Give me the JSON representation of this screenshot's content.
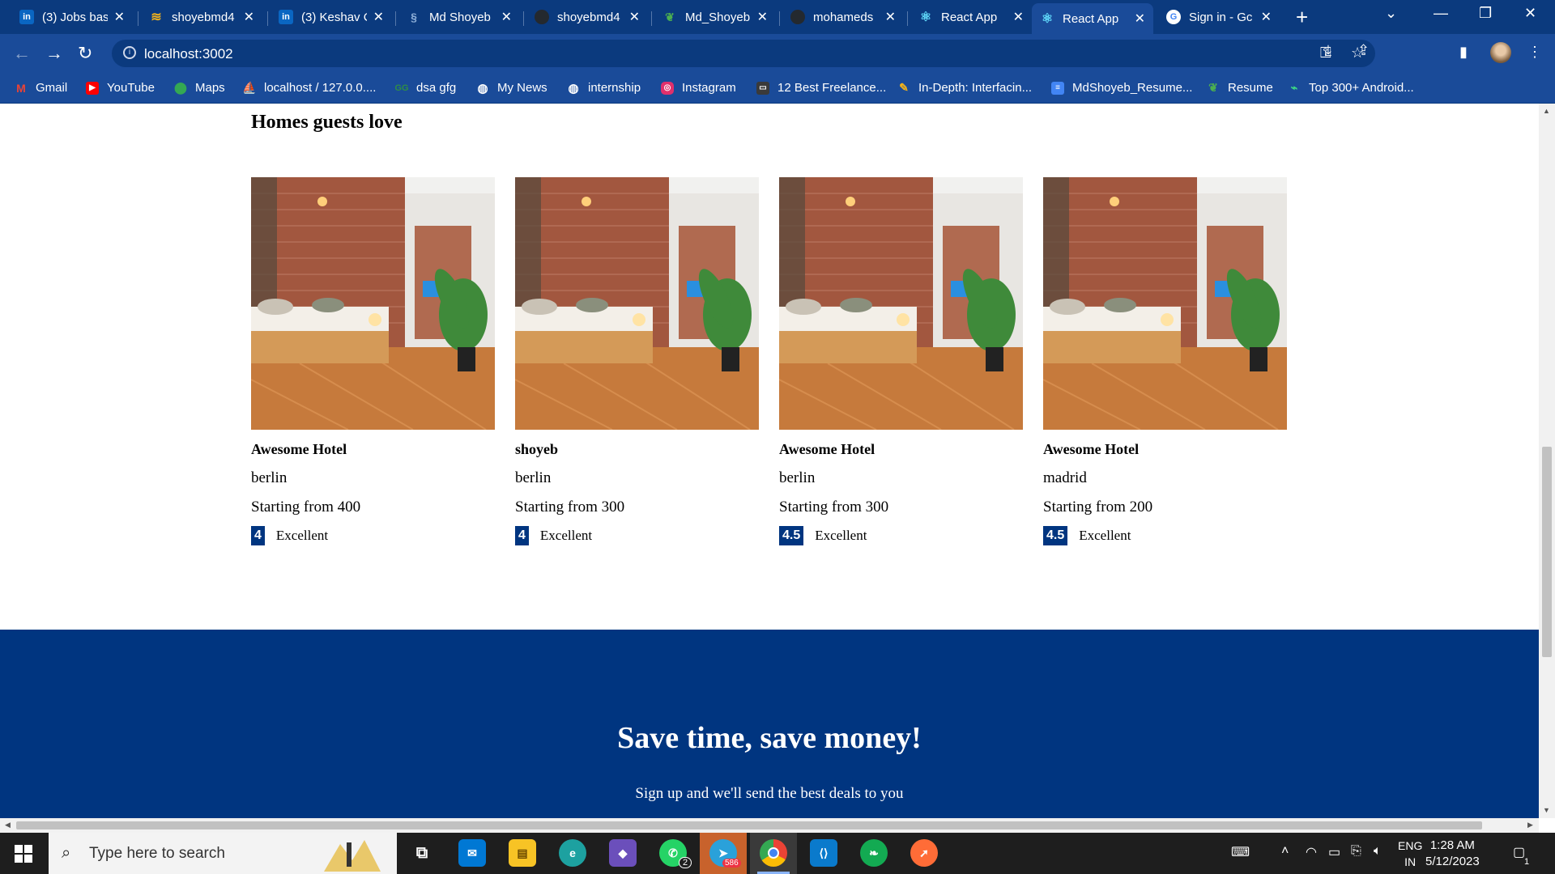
{
  "browser": {
    "tabs": [
      {
        "label": "(3) Jobs bas",
        "favicon": "linkedin-icon",
        "color": "#0a66c2"
      },
      {
        "label": "shoyebmd4",
        "favicon": "bookmark-stack-icon",
        "color": "#f2b21b"
      },
      {
        "label": "(3) Keshav C",
        "favicon": "linkedin-icon",
        "color": "#0a66c2"
      },
      {
        "label": "Md Shoyeb",
        "favicon": "logo-icon",
        "color": "#3b6fa8"
      },
      {
        "label": "shoyebmd4",
        "favicon": "github-icon",
        "color": "#24292f"
      },
      {
        "label": "Md_Shoyeb",
        "favicon": "leaf-icon",
        "color": "#4caf50"
      },
      {
        "label": "mohameds",
        "favicon": "github-icon",
        "color": "#24292f"
      },
      {
        "label": "React App",
        "favicon": "react-icon",
        "color": "#61dafb"
      },
      {
        "label": "React App",
        "favicon": "react-icon",
        "color": "#61dafb",
        "active": true
      },
      {
        "label": "Sign in - Gc",
        "favicon": "google-icon",
        "color": "#ffffff"
      }
    ],
    "url": "localhost:3002",
    "bookmarks": [
      {
        "label": "Gmail",
        "icon": "gmail-icon",
        "color": "#ea4335"
      },
      {
        "label": "YouTube",
        "icon": "youtube-icon",
        "color": "#ff0000"
      },
      {
        "label": "Maps",
        "icon": "maps-icon",
        "color": "#34a853"
      },
      {
        "label": "localhost / 127.0.0....",
        "icon": "phpmyadmin-icon",
        "color": "#f28c00"
      },
      {
        "label": "dsa gfg",
        "icon": "gfg-icon",
        "color": "#2f8d46"
      },
      {
        "label": "My News",
        "icon": "globe-icon",
        "color": "#ffffff"
      },
      {
        "label": "internship",
        "icon": "globe-icon",
        "color": "#ffffff"
      },
      {
        "label": "Instagram",
        "icon": "instagram-icon",
        "color": "#e1306c"
      },
      {
        "label": "12 Best Freelance...",
        "icon": "site-icon",
        "color": "#3a3a3a"
      },
      {
        "label": "In-Depth: Interfacin...",
        "icon": "pen-icon",
        "color": "#f2b21b"
      },
      {
        "label": "MdShoyeb_Resume...",
        "icon": "docs-icon",
        "color": "#4285f4"
      },
      {
        "label": "Resume",
        "icon": "leaf-icon",
        "color": "#4caf50"
      },
      {
        "label": "Top 300+ Android...",
        "icon": "android-icon",
        "color": "#3ddc84"
      }
    ]
  },
  "page": {
    "section_title": "Homes guests love",
    "hotels": [
      {
        "name": "Awesome Hotel",
        "city": "berlin",
        "price": "Starting from 400",
        "score": "4",
        "rating_text": "Excellent"
      },
      {
        "name": "shoyeb",
        "city": "berlin",
        "price": "Starting from 300",
        "score": "4",
        "rating_text": "Excellent"
      },
      {
        "name": "Awesome Hotel",
        "city": "berlin",
        "price": "Starting from 300",
        "score": "4.5",
        "rating_text": "Excellent"
      },
      {
        "name": "Awesome Hotel",
        "city": "madrid",
        "price": "Starting from 200",
        "score": "4.5",
        "rating_text": "Excellent"
      }
    ],
    "mail": {
      "title": "Save time, save money!",
      "description": "Sign up and we'll send the best deals to you"
    },
    "colors": {
      "brand": "#003580",
      "chrome": "#1a4b99"
    }
  },
  "taskbar": {
    "search_placeholder": "Type here to search",
    "apps": [
      {
        "icon": "task-view-icon"
      },
      {
        "icon": "mail-icon",
        "color": "#0078d4"
      },
      {
        "icon": "file-explorer-icon",
        "color": "#f7c325"
      },
      {
        "icon": "edge-icon",
        "color": "#1da1a0"
      },
      {
        "icon": "copilot-icon",
        "color": "#6b4fbb"
      },
      {
        "icon": "whatsapp-icon",
        "color": "#25d366",
        "badge": "2"
      },
      {
        "icon": "telegram-icon",
        "color": "#2aa1da",
        "badge": "586"
      },
      {
        "icon": "chrome-icon",
        "color": "#ea4335"
      },
      {
        "icon": "vscode-icon",
        "color": "#0a7acc"
      },
      {
        "icon": "mongodb-icon",
        "color": "#13aa52"
      },
      {
        "icon": "postman-icon",
        "color": "#ff6c37"
      }
    ],
    "language": {
      "line1": "ENG",
      "line2": "IN"
    },
    "time": "1:28 AM",
    "date": "5/12/2023",
    "notification_count": "1"
  }
}
